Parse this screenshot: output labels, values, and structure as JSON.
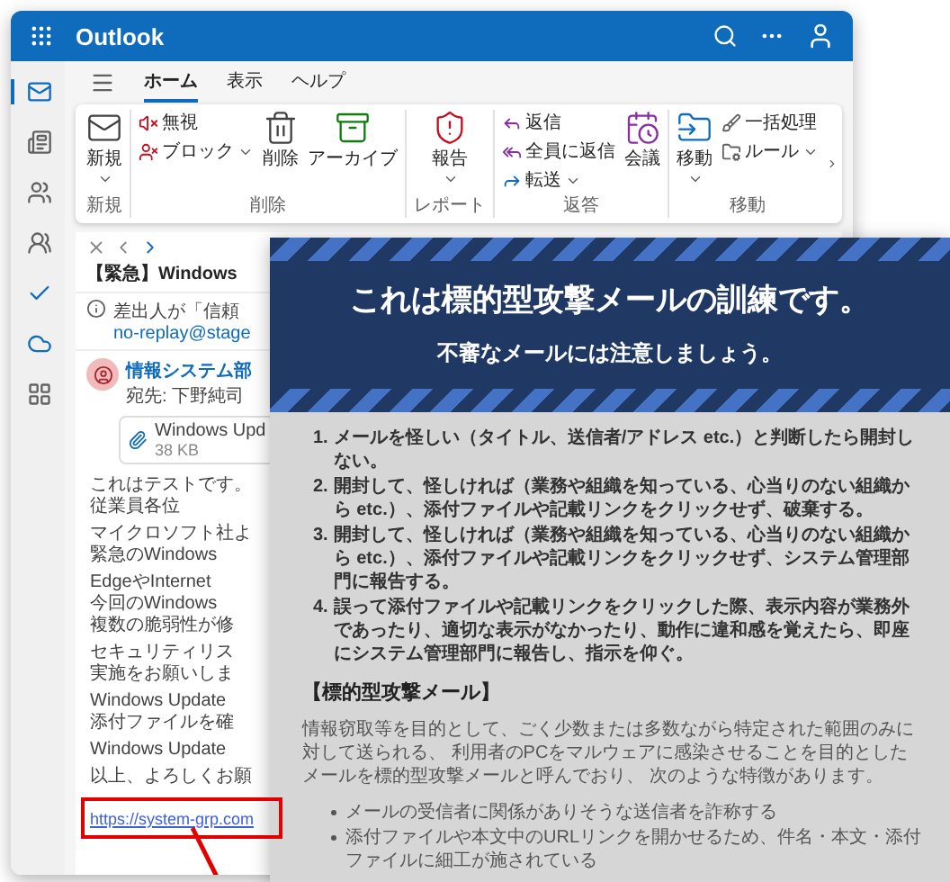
{
  "outlook": {
    "app_name": "Outlook",
    "rail": [
      {
        "selected": true
      },
      {
        "selected": false
      },
      {
        "selected": false
      },
      {
        "selected": false
      },
      {
        "selected": false
      },
      {
        "selected": false
      },
      {
        "selected": false
      }
    ],
    "tabs": [
      {
        "label": "ホーム",
        "selected": true
      },
      {
        "label": "表示",
        "selected": false
      },
      {
        "label": "ヘルプ",
        "selected": false
      }
    ],
    "ribbon": [
      {
        "label": "新規",
        "items": [
          {
            "kind": "large",
            "label": "新規",
            "dropdown": true
          }
        ]
      },
      {
        "label": "削除",
        "items": [
          {
            "kind": "stack",
            "entries": [
              {
                "label": "無視",
                "dropdown": false
              },
              {
                "label": "ブロック",
                "dropdown": true
              }
            ]
          },
          {
            "kind": "large",
            "label": "削除",
            "dropdown": false
          },
          {
            "kind": "large",
            "label": "アーカイブ",
            "dropdown": false
          }
        ]
      },
      {
        "label": "レポート",
        "items": [
          {
            "kind": "large",
            "label": "報告",
            "dropdown": true
          }
        ]
      },
      {
        "label": "返答",
        "items": [
          {
            "kind": "stack",
            "entries": [
              {
                "label": "返信",
                "dropdown": false
              },
              {
                "label": "全員に返信",
                "dropdown": false
              },
              {
                "label": "転送",
                "dropdown": true
              }
            ]
          },
          {
            "kind": "large",
            "label": "会議",
            "dropdown": false
          }
        ]
      },
      {
        "label": "移動",
        "items": [
          {
            "kind": "large",
            "label": "移動",
            "dropdown": true
          },
          {
            "kind": "stack",
            "entries": [
              {
                "label": "一括処理",
                "dropdown": false
              },
              {
                "label": "ルール",
                "dropdown": true
              }
            ]
          }
        ]
      }
    ],
    "message": {
      "subject": "【緊急】Windows",
      "warning": {
        "text": "差出人が「信頼",
        "address": "no-replay@stage"
      },
      "sender": {
        "name": "情報システム部",
        "to": "宛先: 下野純司"
      },
      "attachment": {
        "name": "Windows Upd",
        "size": "38 KB"
      },
      "body": [
        [
          "これはテストです。",
          "従業員各位"
        ],
        [
          "マイクロソフト社よ",
          "緊急のWindows"
        ],
        [
          "EdgeやInternet",
          "今回のWindows",
          "複数の脆弱性が修"
        ],
        [
          "セキュリティリス",
          "実施をお願いしま"
        ],
        [
          "Windows Update",
          "添付ファイルを確"
        ],
        [
          "Windows Update"
        ],
        [
          "以上、よろしくお願"
        ]
      ],
      "link": "https://system-grp.com"
    }
  },
  "training": {
    "title": "これは標的型攻撃メールの訓練です。",
    "subtitle": "不審なメールには注意しましょう。",
    "steps": [
      {
        "number": "1.",
        "text": "メールを怪しい（タイトル、送信者/アドレス etc.）と判断したら開封しない。"
      },
      {
        "number": "2.",
        "text": "開封して、怪しければ（業務や組織を知っている、心当りのない組織から etc.）、添付ファイルや記載リンクをクリックせず、破棄する。"
      },
      {
        "number": "3.",
        "text": "開封して、怪しければ（業務や組織を知っている、心当りのない組織から etc.）、添付ファイルや記載リンクをクリックせず、システム管理部門に報告する。"
      },
      {
        "number": "4.",
        "text": "誤って添付ファイルや記載リンクをクリックした際、表示内容が業務外であったり、適切な表示がなかったり、動作に違和感を覚えたら、即座にシステム管理部門に報告し、指示を仰ぐ。"
      }
    ],
    "heading": "【標的型攻撃メール】",
    "description": "情報窃取等を目的として、ごく少数または多数ながら特定された範囲のみに対して送られる、 利用者のPCをマルウェアに感染させることを目的としたメールを標的型攻撃メールと呼んでおり、 次のような特徴があります。",
    "features": [
      "メールの受信者に関係がありそうな送信者を詐称する",
      "添付ファイルや本文中のURLリンクを開かせるため、件名・本文・添付ファイルに細工が施されている"
    ]
  }
}
